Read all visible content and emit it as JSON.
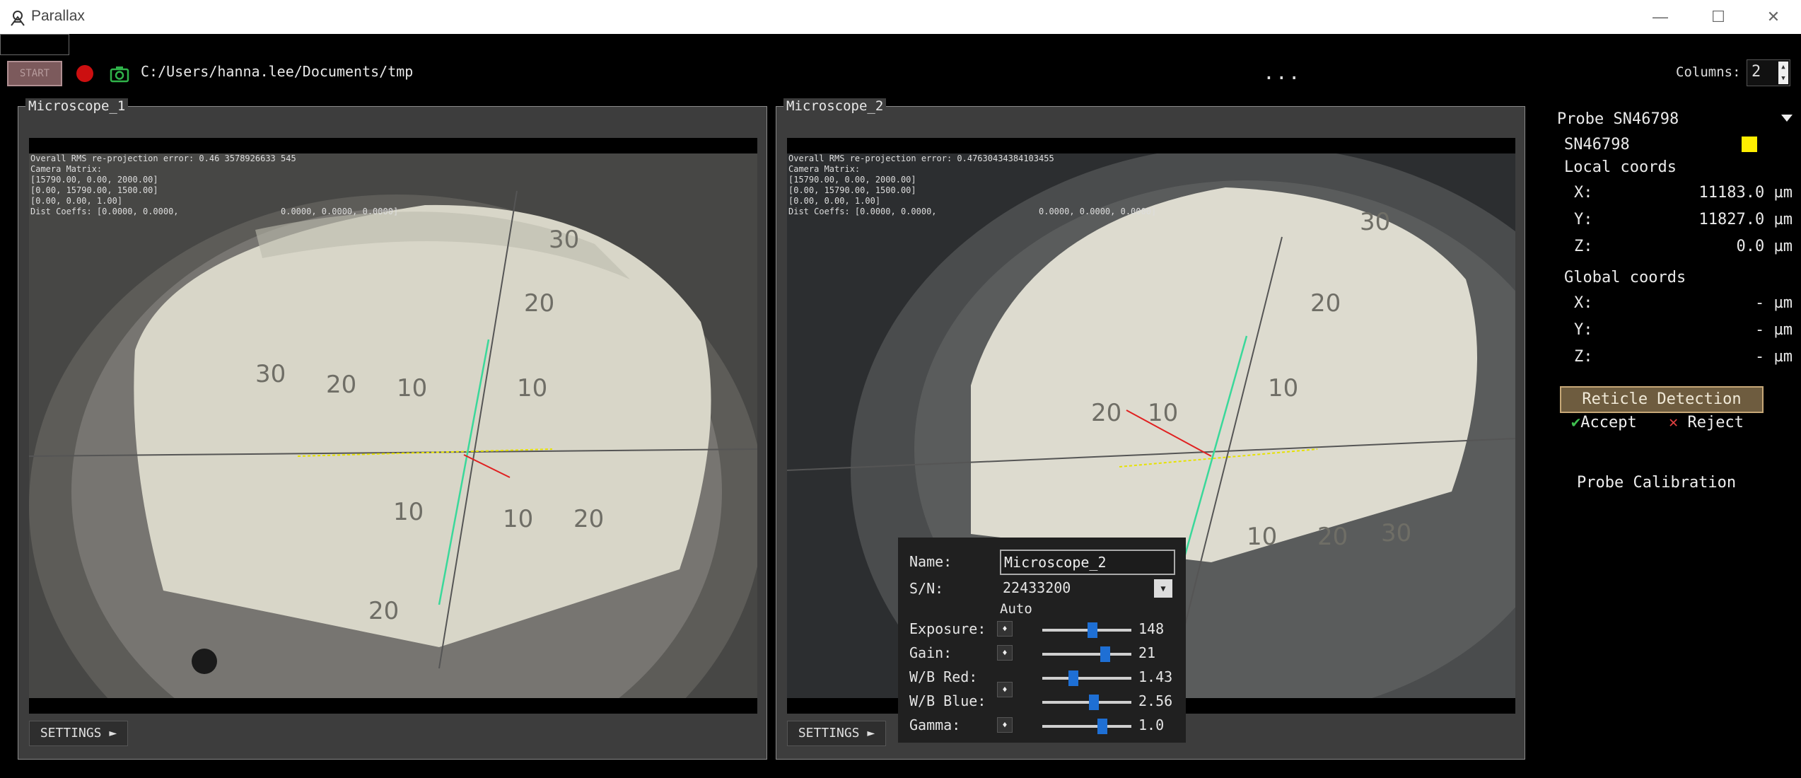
{
  "window": {
    "title": "Parallax",
    "controls": {
      "minimize": "—",
      "maximize": "☐",
      "close": "✕"
    }
  },
  "toolbar": {
    "start_label": "START",
    "path": "C:/Users/hanna.lee/Documents/tmp",
    "more_label": "...",
    "columns_label": "Columns:",
    "columns_value": "2"
  },
  "microscopes": [
    {
      "title": "Microscope_1",
      "overlay": "Overall RMS re-projection error: 0.46 3578926633 545\nCamera Matrix:\n[15790.00, 0.00, 2000.00]\n[0.00, 15790.00, 1500.00]\n[0.00, 0.00, 1.00]\nDist Coeffs: [0.0000, 0.0000,                    0.0000, 0.0000, 0.0000]",
      "settings_label": "SETTINGS ►"
    },
    {
      "title": "Microscope_2",
      "overlay": "Overall RMS re-projection error: 0.47630434384103455\nCamera Matrix:\n[15790.00, 0.00, 2000.00]\n[0.00, 15790.00, 1500.00]\n[0.00, 0.00, 1.00]\nDist Coeffs: [0.0000, 0.0000,                    0.0000, 0.0000, 0.0000]",
      "settings_label": "SETTINGS ►"
    }
  ],
  "settings_panel": {
    "name_label": "Name:",
    "name_value": "Microscope_2",
    "sn_label": "S/N:",
    "sn_value": "22433200",
    "auto_label": "Auto",
    "rows": [
      {
        "label": "Exposure:",
        "value": "148",
        "fraction": 0.57
      },
      {
        "label": "Gain:",
        "value": "21",
        "fraction": 0.73
      },
      {
        "label": "W/B Red:",
        "value": "1.43",
        "fraction": 0.33
      },
      {
        "label": "W/B Blue:",
        "value": "2.56",
        "fraction": 0.59
      },
      {
        "label": "Gamma:",
        "value": "1.0",
        "fraction": 0.7
      }
    ]
  },
  "probe": {
    "header": "Probe SN46798",
    "name": "SN46798",
    "color": "#ffee00",
    "local_title": "Local coords",
    "local": [
      {
        "axis": "X:",
        "value": "11183.0 µm"
      },
      {
        "axis": "Y:",
        "value": "11827.0 µm"
      },
      {
        "axis": "Z:",
        "value": "0.0 µm"
      }
    ],
    "global_title": "Global coords",
    "global": [
      {
        "axis": "X:",
        "value": "- µm"
      },
      {
        "axis": "Y:",
        "value": "- µm"
      },
      {
        "axis": "Z:",
        "value": "- µm"
      }
    ],
    "reticle_detection_label": "Reticle Detection",
    "accept_label": "Accept",
    "reject_label": "Reject",
    "probe_calibration_label": "Probe Calibration"
  }
}
